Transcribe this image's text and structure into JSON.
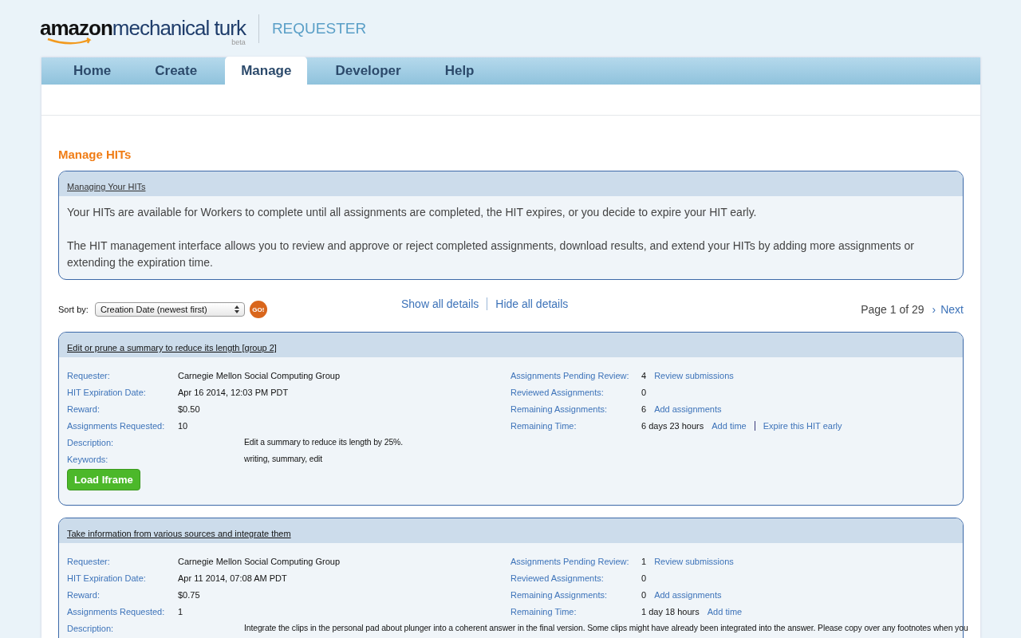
{
  "logo": {
    "brand": "amazon",
    "product": "mechanical turk",
    "badge": "beta",
    "section": "REQUESTER"
  },
  "tabs": [
    {
      "label": "Home",
      "selected": false
    },
    {
      "label": "Create",
      "selected": false
    },
    {
      "label": "Manage",
      "selected": true
    },
    {
      "label": "Developer",
      "selected": false
    },
    {
      "label": "Help",
      "selected": false
    }
  ],
  "page_title": "Manage HITs",
  "info_box": {
    "heading": "Managing Your HITs",
    "paragraphs": [
      "Your HITs are available for Workers to complete until all assignments are completed, the HIT expires, or you decide to expire your HIT early.",
      "The HIT management interface allows you to review and approve or reject completed assignments, download results, and extend your HITs by adding more assignments or extending the expiration time."
    ]
  },
  "sort": {
    "label": "Sort by:",
    "value": "Creation Date (newest first)",
    "go": "GO!"
  },
  "detail_links": [
    "Show all details",
    "Hide all details"
  ],
  "pager": {
    "text": "Page 1 of 29",
    "arrow": "›",
    "next": "Next"
  },
  "hits": [
    {
      "title": "Edit or prune a summary to reduce its length [group 2]",
      "fields": [
        {
          "label": "Requester:",
          "value": "Carnegie Mellon Social Computing Group"
        },
        {
          "label": "HIT Expiration Date:",
          "value": "Apr 16 2014, 12:03 PM PDT"
        },
        {
          "label": "Reward:",
          "value": "$0.50"
        },
        {
          "label": "Assignments Requested:",
          "value": "10"
        }
      ],
      "wide_fields": [
        {
          "label": "Description:",
          "value": "Edit a summary to reduce its length by 25%."
        },
        {
          "label": "Keywords:",
          "value": "writing, summary, edit"
        }
      ],
      "stats": [
        {
          "label": "Assignments Pending Review:",
          "value": "4",
          "links": [
            "Review submissions"
          ]
        },
        {
          "label": "Reviewed Assignments:",
          "value": "0"
        },
        {
          "label": "Remaining Assignments:",
          "value": "6",
          "links": [
            "Add assignments"
          ]
        },
        {
          "label": "Remaining Time:",
          "value": "6 days 23 hours",
          "links": [
            "Add time",
            "Expire this HIT early"
          ]
        }
      ],
      "button": "Load Iframe"
    },
    {
      "title": "Take information from various sources and integrate them",
      "fields": [
        {
          "label": "Requester:",
          "value": "Carnegie Mellon Social Computing Group"
        },
        {
          "label": "HIT Expiration Date:",
          "value": "Apr 11 2014, 07:08 AM PDT"
        },
        {
          "label": "Reward:",
          "value": "$0.75"
        },
        {
          "label": "Assignments Requested:",
          "value": "1"
        }
      ],
      "wide_fields": [
        {
          "label": "Description:",
          "value": "Integrate the clips in the personal pad about plunger into a coherent answer in the final version. Some clips might have already been integrated into the answer. Please copy over any footnotes when you"
        }
      ],
      "stats": [
        {
          "label": "Assignments Pending Review:",
          "value": "1",
          "links": [
            "Review submissions"
          ]
        },
        {
          "label": "Reviewed Assignments:",
          "value": "0"
        },
        {
          "label": "Remaining Assignments:",
          "value": "0",
          "links": [
            "Add assignments"
          ]
        },
        {
          "label": "Remaining Time:",
          "value": "1 day 18 hours",
          "links": [
            "Add time"
          ]
        }
      ]
    }
  ]
}
